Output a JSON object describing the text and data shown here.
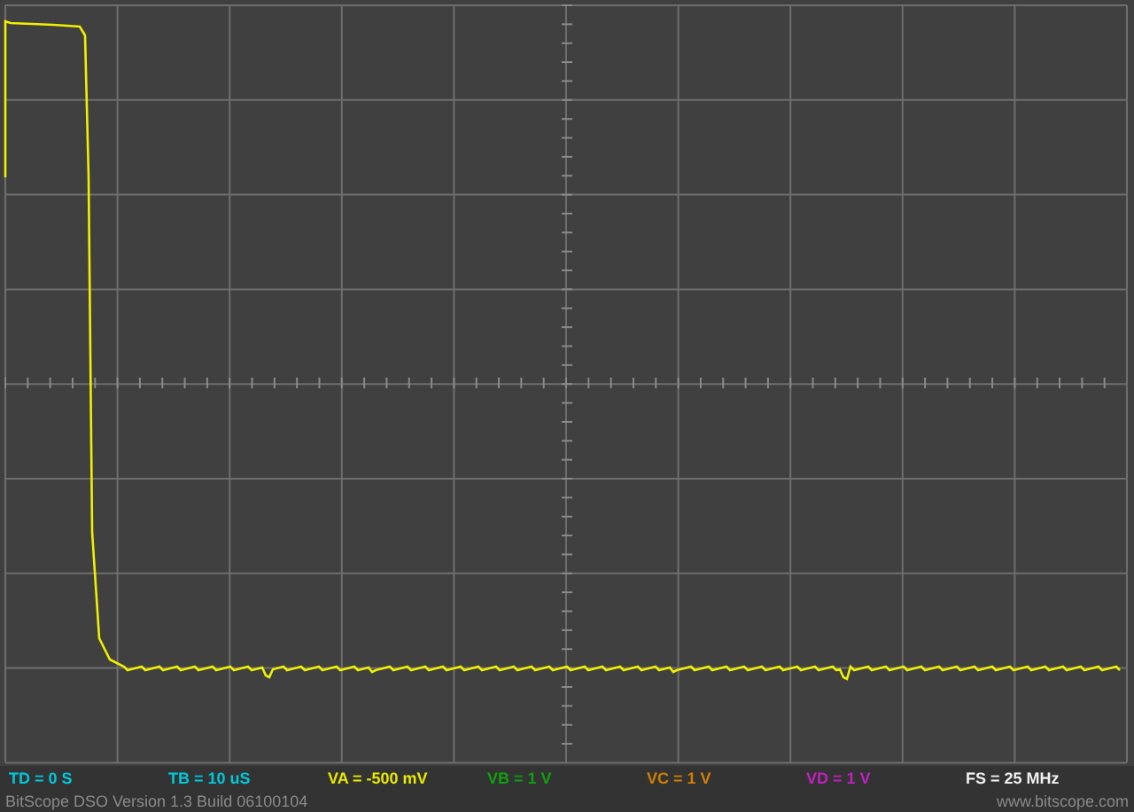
{
  "readouts": [
    {
      "text": "TD = 0 S",
      "color": "#00c8d8"
    },
    {
      "text": "TB = 10 uS",
      "color": "#00c8d8"
    },
    {
      "text": "VA = -500 mV",
      "color": "#e8e800"
    },
    {
      "text": "VB = 1 V",
      "color": "#10a010"
    },
    {
      "text": "VC = 1 V",
      "color": "#d08000"
    },
    {
      "text": "VD = 1 V",
      "color": "#c020c0"
    },
    {
      "text": "FS = 25 MHz",
      "color": "#f0f0f0"
    }
  ],
  "status_bar": {
    "version": "BitScope DSO Version 1.3 Build 06100104",
    "url": "www.bitscope.com"
  }
}
